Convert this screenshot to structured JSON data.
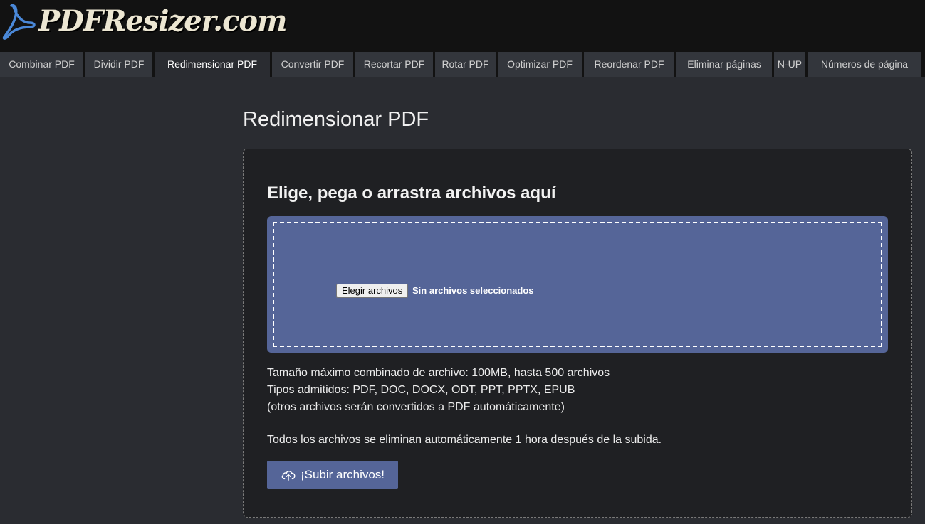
{
  "header": {
    "logo_text": "PDFResizer.com",
    "logo_icon": "acrobat-logo-icon"
  },
  "nav": {
    "tabs": [
      {
        "label": "Combinar PDF",
        "active": false
      },
      {
        "label": "Dividir PDF",
        "active": false
      },
      {
        "label": "Redimensionar PDF",
        "active": true
      },
      {
        "label": "Convertir PDF",
        "active": false
      },
      {
        "label": "Recortar PDF",
        "active": false
      },
      {
        "label": "Rotar PDF",
        "active": false
      },
      {
        "label": "Optimizar PDF",
        "active": false
      },
      {
        "label": "Reordenar PDF",
        "active": false
      },
      {
        "label": "Eliminar páginas",
        "active": false
      },
      {
        "label": "N-UP",
        "active": false
      },
      {
        "label": "Números de página",
        "active": false
      }
    ]
  },
  "main": {
    "title": "Redimensionar PDF",
    "panel_heading": "Elige, pega o arrastra archivos aquí",
    "file_input": {
      "button_label": "Elegir archivos",
      "status": "Sin archivos seleccionados"
    },
    "info_lines": [
      "Tamaño máximo combinado de archivo: 100MB, hasta 500 archivos",
      "Tipos admitidos: PDF, DOC, DOCX, ODT, PPT, PPTX, EPUB",
      "(otros archivos serán convertidos a PDF automáticamente)"
    ],
    "deletion_notice": "Todos los archivos se eliminan automáticamente 1 hora después de la subida.",
    "upload_button": {
      "label": "¡Subir archivos!",
      "icon": "cloud-upload-icon"
    }
  },
  "colors": {
    "accent": "#556598",
    "background": "#2a2c31",
    "panel": "#1f2023",
    "header": "#121212"
  }
}
